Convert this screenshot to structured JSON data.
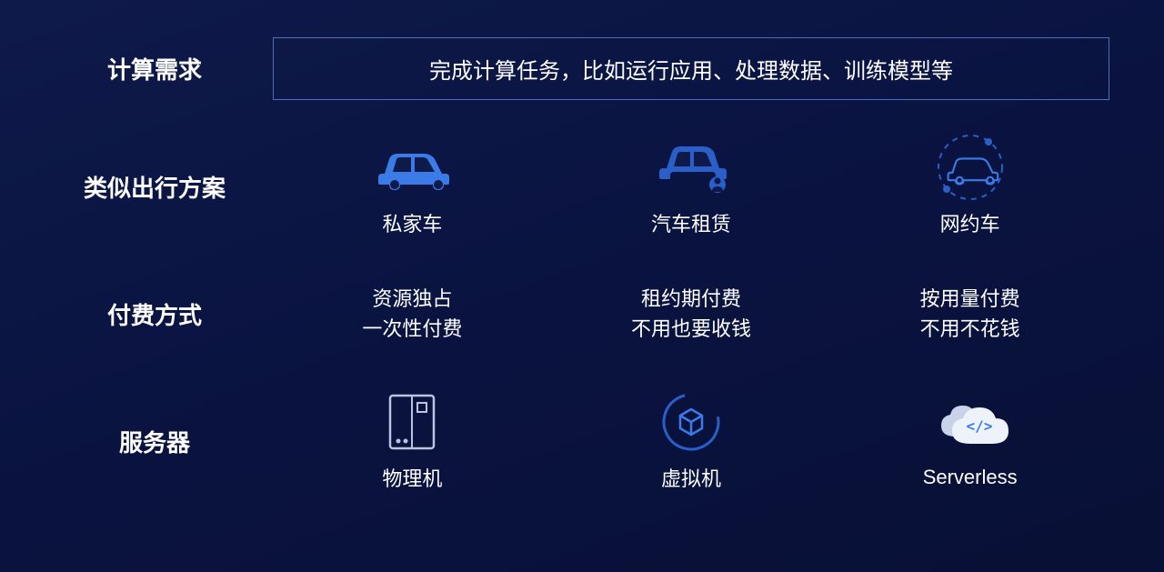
{
  "rows": {
    "demand": "计算需求",
    "travel": "类似出行方案",
    "payment": "付费方式",
    "server": "服务器"
  },
  "demand_text": "完成计算任务，比如运行应用、处理数据、训练模型等",
  "travel": {
    "col1": "私家车",
    "col2": "汽车租赁",
    "col3": "网约车"
  },
  "payment": {
    "col1_line1": "资源独占",
    "col1_line2": "一次性付费",
    "col2_line1": "租约期付费",
    "col2_line2": "不用也要收钱",
    "col3_line1": "按用量付费",
    "col3_line2": "不用不花钱"
  },
  "server": {
    "col1": "物理机",
    "col2": "虚拟机",
    "col3": "Serverless"
  }
}
